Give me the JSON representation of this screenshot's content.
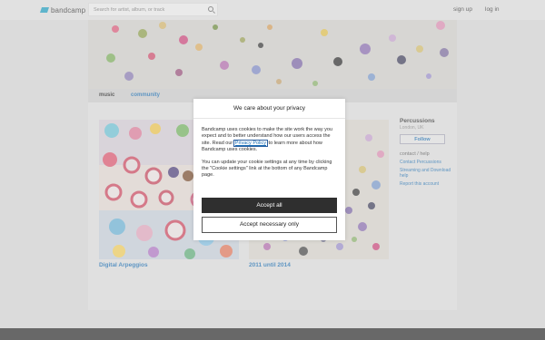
{
  "topbar": {
    "logo_text": "bandcamp",
    "search_placeholder": "Search for artist, album, or track",
    "signup": "sign up",
    "login": "log in"
  },
  "nav": {
    "music": "music",
    "community": "community"
  },
  "albums": [
    {
      "title": "Digital Arpeggios"
    },
    {
      "title": "2011 until 2014"
    }
  ],
  "sidebar": {
    "band_name": "Percussions",
    "location": "London, UK",
    "follow": "Follow",
    "contact_heading": "contact / help",
    "links": [
      "Contact Percussions",
      "Streaming and Download help",
      "Report this account"
    ]
  },
  "modal": {
    "title": "We care about your privacy",
    "para1_before": "Bandcamp uses cookies to make the site work the way you expect and to better understand how our users access the site. Read our",
    "privacy_link": "Privacy Policy",
    "para1_after": "to learn more about how Bandcamp uses cookies.",
    "para2": "You can update your cookie settings at any time by clicking the \"Cookie settings\" link at the bottom of any Bandcamp page.",
    "accept_all": "Accept all",
    "accept_necessary": "Accept necessary only"
  },
  "colors": {
    "accent": "#1a6fb5",
    "logo": "#1da0c3",
    "footer": "#2a2a2a",
    "dark_button": "#2f2f2f"
  }
}
